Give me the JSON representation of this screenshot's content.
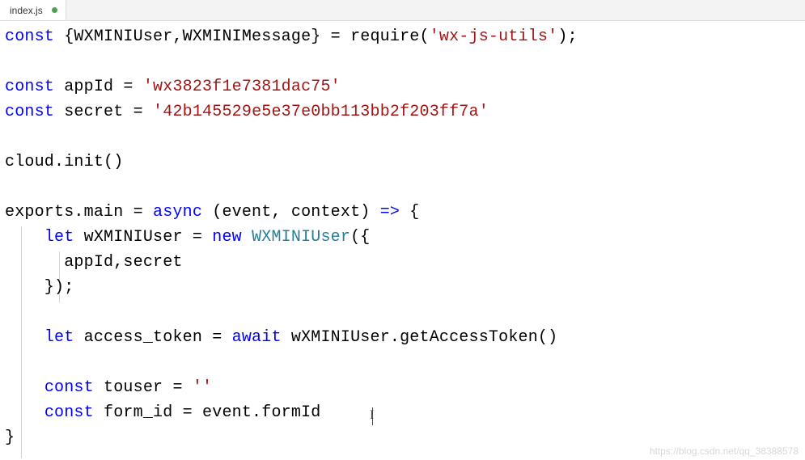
{
  "tab": {
    "filename": "index.js",
    "modified": true
  },
  "code": {
    "l1": {
      "kw1": "const",
      "t1": " {WXMINIUser,WXMINIMessage} = require(",
      "str1": "'wx-js-utils'",
      "t2": ");"
    },
    "l3": {
      "kw1": "const",
      "t1": " appId = ",
      "str1": "'wx3823f1e7381dac75'"
    },
    "l4": {
      "kw1": "const",
      "t1": " secret = ",
      "str1": "'42b145529e5e37e0bb113bb2f203ff7a'"
    },
    "l6": {
      "t1": "cloud.init()"
    },
    "l8": {
      "t1": "exports.main = ",
      "kw1": "async",
      "t2": " (event, context) ",
      "kw2": "=>",
      "t3": " {"
    },
    "l9": {
      "pad": "    ",
      "kw1": "let",
      "t1": " wXMINIUser = ",
      "kw2": "new",
      "t2": " ",
      "type1": "WXMINIUser",
      "t3": "({"
    },
    "l10": {
      "t1": "      appId,secret"
    },
    "l11": {
      "t1": "    });"
    },
    "l13": {
      "pad": "    ",
      "kw1": "let",
      "t1": " access_token = ",
      "kw2": "await",
      "t2": " wXMINIUser.getAccessToken()"
    },
    "l15": {
      "pad": "    ",
      "kw1": "const",
      "t1": " touser = ",
      "str1": "''"
    },
    "l16": {
      "pad": "    ",
      "kw1": "const",
      "t1": " form_id = event.formId"
    },
    "l17": {
      "t1": "}"
    }
  },
  "watermark": "https://blog.csdn.net/qq_38388578"
}
